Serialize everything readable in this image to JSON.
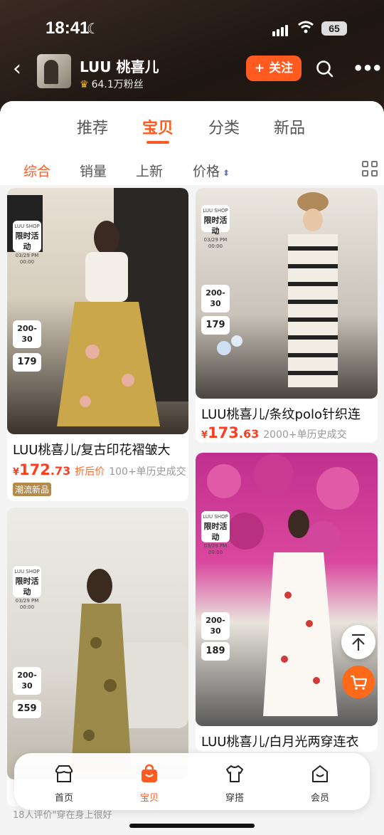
{
  "status": {
    "time": "18:41",
    "battery": "65"
  },
  "shop": {
    "name": "LUU 桃喜儿",
    "fans": "64.1万粉丝",
    "follow_label": "+ 关注",
    "more_label": "•••"
  },
  "tabs": [
    "推荐",
    "宝贝",
    "分类",
    "新品"
  ],
  "sort": {
    "comprehensive": "综合",
    "sales": "销量",
    "new": "上新",
    "price": "价格"
  },
  "badges": {
    "shop": "LUU SHOP",
    "promo": "限时活动",
    "date": "03/29 PM 00:00",
    "deal": "200-30",
    "card1_price": "179",
    "card2_price": "179",
    "card3_price": "259",
    "card4_price": "189"
  },
  "products": [
    {
      "title": "LUU桃喜儿/复古印花褶皱大",
      "yen": "¥",
      "price_int": "172",
      "price_dec": ".73",
      "discount": "折后价",
      "sold": "100+单历史成交",
      "tag": "潮流新品"
    },
    {
      "title": "LUU桃喜儿/条纹polo针织连",
      "yen": "¥",
      "price_int": "173",
      "price_dec": ".63",
      "sold": "2000+单历史成交"
    },
    {
      "title": "LUU桃喜儿/白月光两穿连衣"
    }
  ],
  "peek_text": "18人评价\"穿在身上很好",
  "bottom_nav": [
    "首页",
    "宝贝",
    "穿搭",
    "会员"
  ],
  "colors": {
    "accent": "#ff5a1f",
    "price": "#ff3d1f"
  }
}
